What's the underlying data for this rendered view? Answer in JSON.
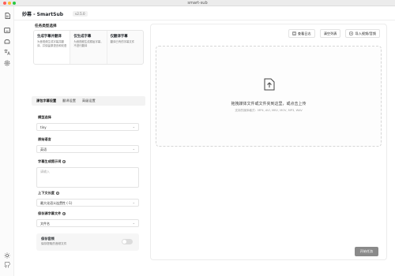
{
  "window": {
    "title": "smart-sub"
  },
  "app": {
    "title": "妙幕 - SmartSub",
    "version": "v2.5.0"
  },
  "sidebar": {
    "icons": [
      "file-icon",
      "subtitle-icon",
      "cloud-icon",
      "translate-icon",
      "settings-icon",
      "sun-icon",
      "github-icon"
    ]
  },
  "task_type": {
    "label": "任务类型选择",
    "cards": [
      {
        "title": "生成字幕并翻译",
        "desc": "为音视频生成字幕并翻译，并保留原语言和双语"
      },
      {
        "title": "仅生成字幕",
        "desc": "为音视频生成原始字幕，不进行翻译"
      },
      {
        "title": "仅翻译字幕",
        "desc": "翻译已有的字幕文件"
      }
    ]
  },
  "tabs": [
    {
      "label": "源包字幕设置"
    },
    {
      "label": "翻译设置"
    },
    {
      "label": "高级设置"
    }
  ],
  "form": {
    "model_label": "模型选择",
    "model_value": "tiny",
    "source_lang_label": "原始语言",
    "source_lang_value": "英语",
    "prompt_label": "字幕生成提示词",
    "prompt_placeholder": "请输入",
    "context_label": "上下文长度",
    "context_value": "最大化语义连贯性 (-1)",
    "save_sub_label": "保存源字幕文件",
    "save_sub_value": "文件名",
    "save_audio_title": "保存音频",
    "save_audio_desc": "保存提取的音频文件"
  },
  "toolbar": {
    "log_label": "查看日志",
    "clear_label": "清空列表",
    "import_label": "导入视频/音频"
  },
  "dropzone": {
    "main": "拖拽媒体文件或文件夹到这里，或点击上传",
    "sub": "支持的媒体格式：MP4, AVI, MKV, MOV, MP3, WAV"
  },
  "start_button": "开始任务"
}
